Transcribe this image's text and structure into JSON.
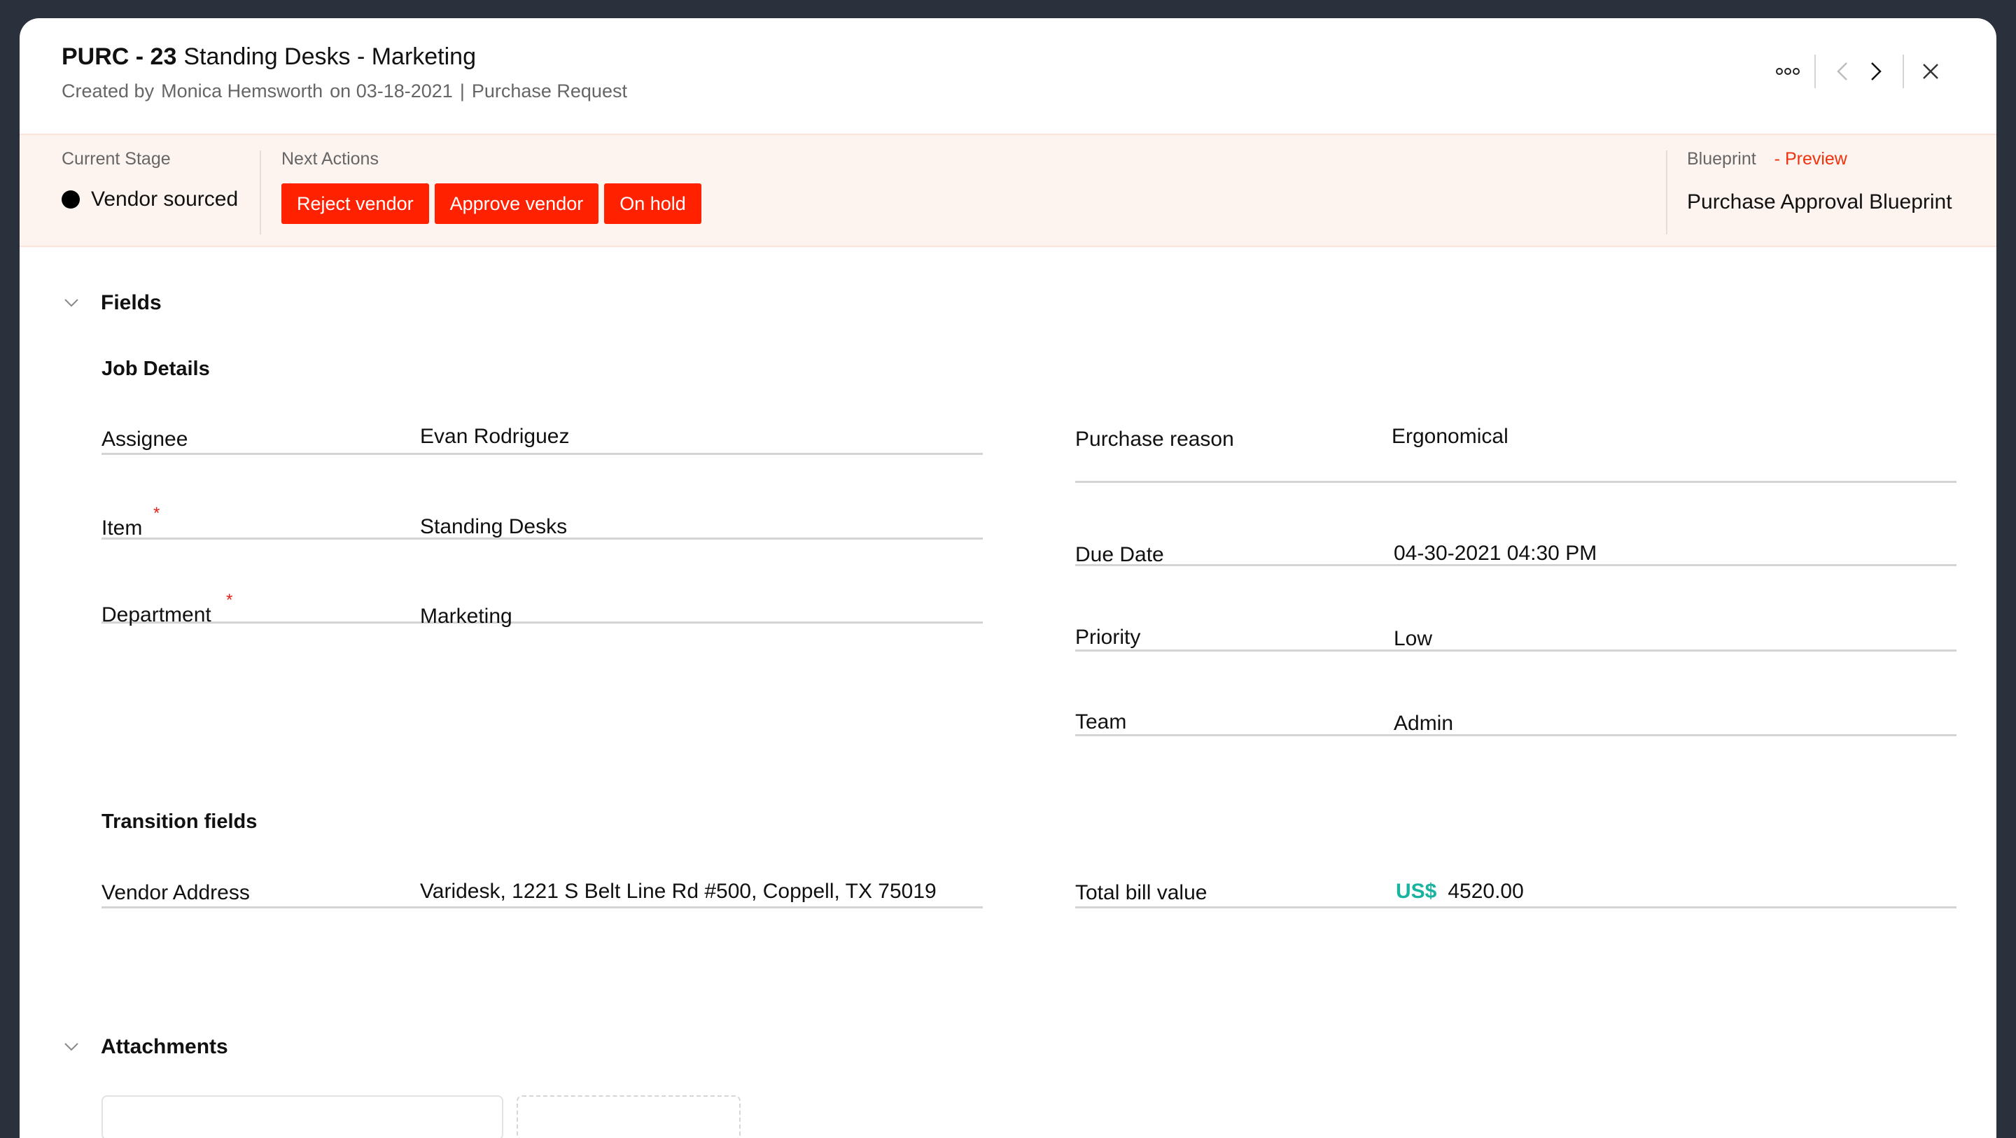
{
  "header": {
    "record_id": "PURC - 23",
    "record_name": "Standing Desks - Marketing",
    "created_by_label": "Created by",
    "created_by": "Monica Hemsworth",
    "created_on": "on 03-18-2021",
    "separator": "|",
    "record_type": "Purchase Request",
    "icons": {
      "more": "more-options-icon",
      "prev": "chevron-left-icon",
      "next": "chevron-right-icon",
      "close": "close-icon"
    }
  },
  "stage_bar": {
    "current_stage_label": "Current Stage",
    "current_stage": "Vendor sourced",
    "next_actions_label": "Next Actions",
    "actions": [
      "Reject vendor",
      "Approve vendor",
      "On hold"
    ],
    "blueprint_label": "Blueprint",
    "blueprint_preview": "- Preview",
    "blueprint_name": "Purchase Approval Blueprint",
    "accent_color": "#ff2100"
  },
  "fields_section": {
    "title": "Fields",
    "job_details": {
      "title": "Job Details",
      "left": [
        {
          "label": "Assignee",
          "value": "Evan Rodriguez",
          "required": false
        },
        {
          "label": "Item",
          "value": "Standing Desks",
          "required": true
        },
        {
          "label": "Department",
          "value": "Marketing",
          "required": true
        }
      ],
      "right": [
        {
          "label": "Purchase reason",
          "value": "Ergonomical"
        },
        {
          "label": "Due Date",
          "value": "04-30-2021 04:30 PM"
        },
        {
          "label": "Priority",
          "value": "Low"
        },
        {
          "label": "Team",
          "value": "Admin"
        }
      ]
    },
    "transition_fields": {
      "title": "Transition fields",
      "vendor_address": {
        "label": "Vendor Address",
        "value": "Varidesk, 1221 S Belt Line Rd #500, Coppell, TX 75019"
      },
      "total_bill": {
        "label": "Total bill value",
        "currency": "US$",
        "value": "4520.00",
        "currency_color": "#19b3a0"
      }
    },
    "required_marker": "*"
  },
  "attachments_section": {
    "title": "Attachments"
  }
}
